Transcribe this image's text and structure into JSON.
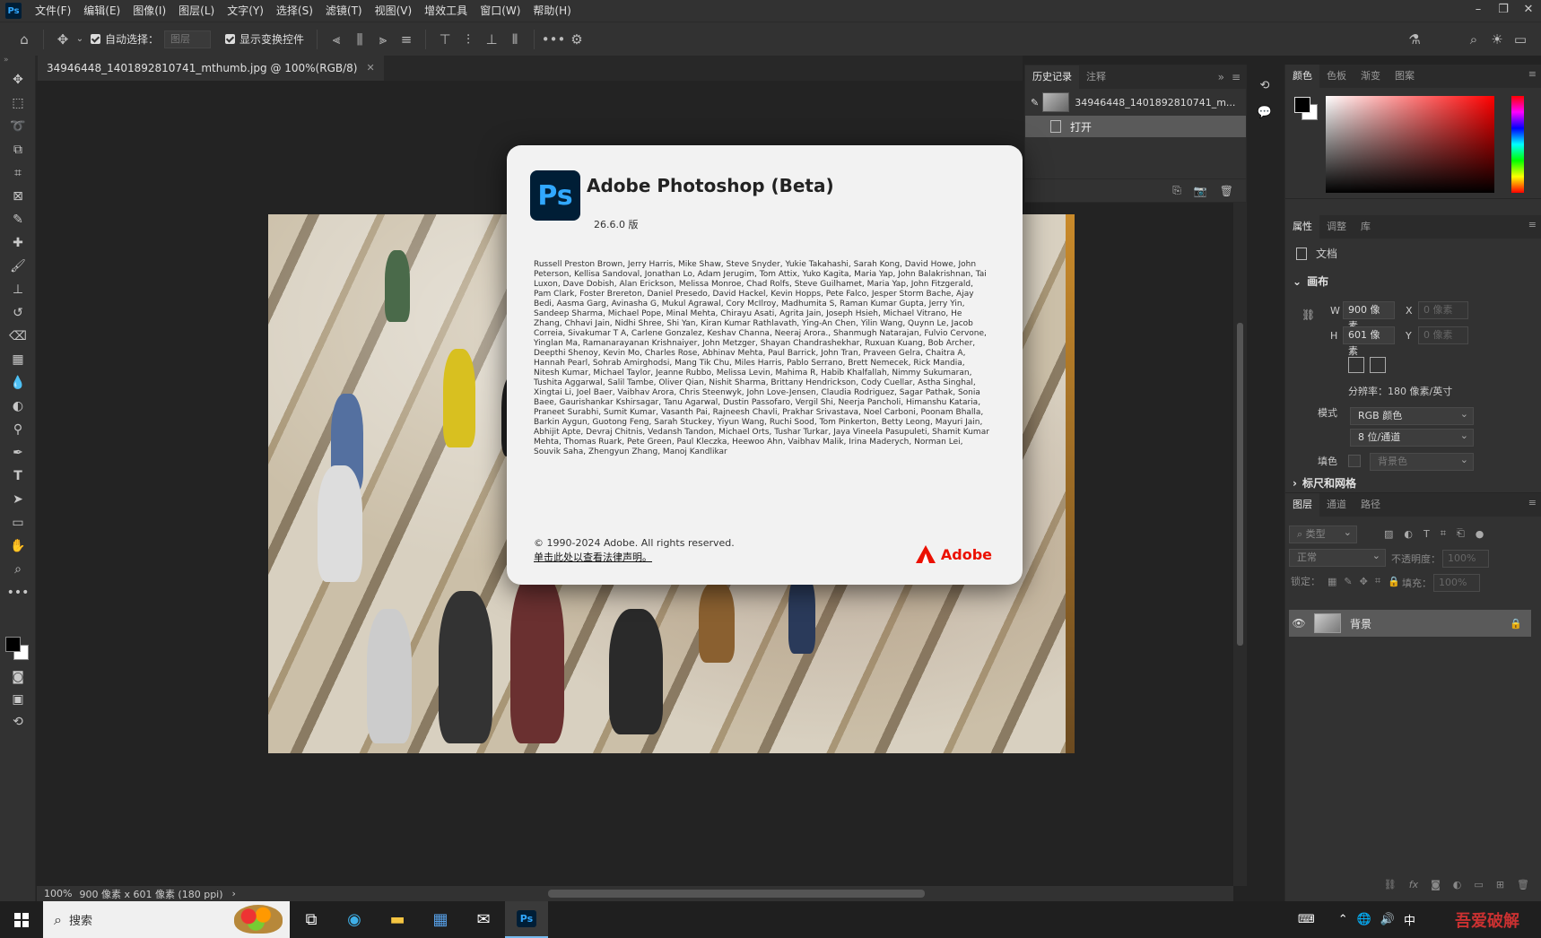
{
  "menubar": {
    "logo": "Ps",
    "items": [
      "文件(F)",
      "编辑(E)",
      "图像(I)",
      "图层(L)",
      "文字(Y)",
      "选择(S)",
      "滤镜(T)",
      "视图(V)",
      "增效工具",
      "窗口(W)",
      "帮助(H)"
    ]
  },
  "options": {
    "auto_select_label": "自动选择：",
    "auto_select_target": "图层",
    "show_transform_label": "显示变换控件"
  },
  "document": {
    "tab_title": "34946448_1401892810741_mthumb.jpg @ 100%(RGB/8)"
  },
  "history": {
    "tabs": [
      "历史记录",
      "注释"
    ],
    "snapshot_name": "34946448_1401892810741_m...",
    "steps": [
      "打开"
    ]
  },
  "color_panel": {
    "tabs": [
      "颜色",
      "色板",
      "渐变",
      "图案"
    ]
  },
  "properties": {
    "tabs": [
      "属性",
      "调整",
      "库"
    ],
    "doc_label": "文档",
    "canvas_head": "画布",
    "w_label": "W",
    "w_value": "900 像素",
    "h_label": "H",
    "h_value": "601 像素",
    "x_label": "X",
    "x_placeholder": "0 像素",
    "y_label": "Y",
    "y_placeholder": "0 像素",
    "resolution": "分辨率：180 像素/英寸",
    "mode_label": "模式",
    "mode_value": "RGB 颜色",
    "depth_value": "8 位/通道",
    "fill_label": "填色",
    "fill_value": "背景色",
    "rulers_head": "标尺和网格"
  },
  "layers": {
    "tabs": [
      "图层",
      "通道",
      "路径"
    ],
    "filter_label": "类型",
    "blend_mode": "正常",
    "opacity_label": "不透明度：",
    "opacity_value": "100%",
    "lock_label": "锁定：",
    "fill_label": "填充：",
    "fill_value": "100%",
    "layer_name": "背景"
  },
  "status": {
    "zoom": "100%",
    "info": "900 像素 x 601 像素 (180 ppi)"
  },
  "about": {
    "app_title": "Adobe Photoshop (Beta)",
    "version": "26.6.0 版",
    "credits": "Russell Preston Brown, Jerry Harris, Mike Shaw, Steve Snyder, Yukie Takahashi, Sarah Kong, David Howe, John Peterson, Kellisa Sandoval, Jonathan Lo, Adam Jerugim, Tom Attix, Yuko Kagita, Maria Yap, John Balakrishnan, Tai Luxon, Dave Dobish, Alan Erickson, Melissa Monroe, Chad Rolfs, Steve Guilhamet, Maria Yap, John Fitzgerald, Pam Clark, Foster Brereton, Daniel Presedo, David Hackel, Kevin Hopps, Pete Falco, Jesper Storm Bache, Ajay Bedi, Aasma Garg, Avinasha G, Mukul Agrawal, Cory McIlroy, Madhumita S, Raman Kumar Gupta, Jerry Yin, Sandeep Sharma, Michael Pope, Minal Mehta, Chirayu Asati, Agrita Jain, Joseph Hsieh, Michael Vitrano, He Zhang, Chhavi Jain, Nidhi Shree, Shi Yan, Kiran Kumar Rathlavath, Ying-An Chen, Yilin Wang, Quynn Le, Jacob Correia, Sivakumar T A, Carlene Gonzalez, Keshav Channa, Neeraj Arora., Shanmugh Natarajan, Fulvio Cervone, Yinglan Ma, Ramanarayanan Krishnaiyer, John Metzger, Shayan Chandrashekhar, Ruxuan Kuang, Bob Archer, Deepthi Shenoy, Kevin Mo, Charles Rose, Abhinav Mehta, Paul Barrick, John Tran, Praveen Gelra, Chaitra A, Hannah Pearl, Sohrab Amirghodsi, Mang Tik Chu, Miles Harris, Pablo Serrano, Brett Nemecek, Rick Mandia, Nitesh Kumar, Michael Taylor, Jeanne Rubbo, Melissa Levin, Mahima R, Habib Khalfallah, Nimmy Sukumaran, Tushita Aggarwal, Salil Tambe, Oliver Qian, Nishit Sharma, Brittany Hendrickson, Cody Cuellar, Astha Singhal, Xingtai Li, Joel Baer, Vaibhav Arora, Chris Steenwyk, John Love-Jensen, Claudia Rodriguez, Sagar Pathak, Sonia Baee, Gaurishankar Kshirsagar, Tanu Agarwal, Dustin Passofaro, Vergil Shi, Neerja Pancholi, Himanshu Kataria, Praneet Surabhi, Sumit Kumar, Vasanth Pai, Rajneesh Chavli, Prakhar Srivastava, Noel Carboni, Poonam Bhalla, Barkin Aygun, Guotong Feng, Sarah Stuckey, Yiyun Wang, Ruchi Sood, Tom Pinkerton, Betty Leong, Mayuri Jain, Abhijit Apte, Devraj Chitnis, Vedansh Tandon, Michael Orts, Tushar Turkar, Jaya Vineela Pasupuleti, Shamit Kumar Mehta, Thomas Ruark, Pete Green, Paul Kleczka, Heewoo Ahn, Vaibhav Malik, Irina Maderych, Norman Lei, Souvik Saha, Zhengyun Zhang, Manoj Kandlikar",
    "copyright": "© 1990-2024 Adobe. All rights reserved.",
    "legal_link": "单击此处以查看法律声明。",
    "adobe_brand": "Adobe"
  },
  "taskbar": {
    "search_label": "搜索",
    "ime": "中",
    "watermark": "吾爱破解"
  },
  "colors": {
    "adobe_red": "#eb1000",
    "ps_blue": "#31a8ff",
    "ps_dark": "#001e36"
  }
}
